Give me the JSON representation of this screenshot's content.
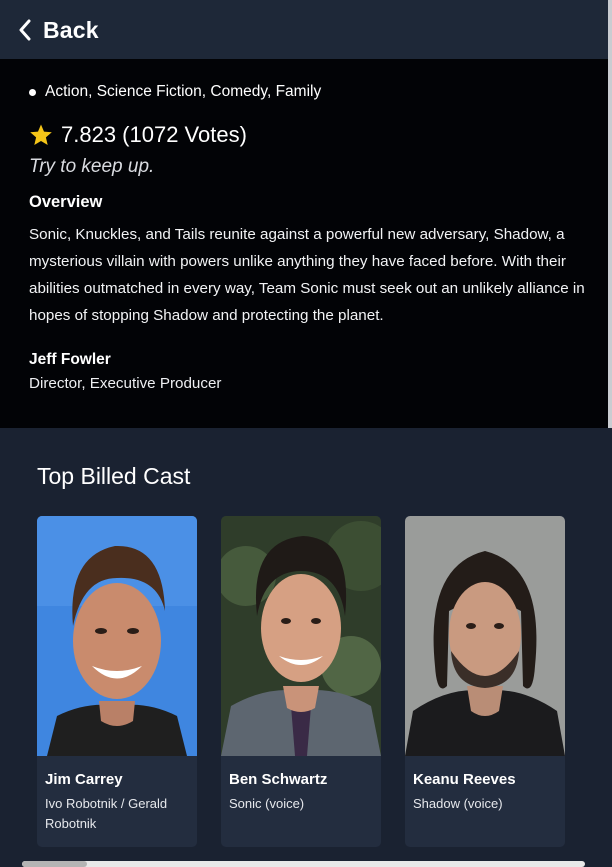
{
  "header": {
    "back_label": "Back"
  },
  "movie": {
    "genres": "Action, Science Fiction, Comedy, Family",
    "rating": "7.823 (1072 Votes)",
    "tagline": "Try to keep up.",
    "overview_title": "Overview",
    "overview": "Sonic, Knuckles, and Tails reunite against a powerful new adversary, Shadow, a mysterious villain with powers unlike anything they have faced before. With their abilities outmatched in every way, Team Sonic must seek out an unlikely alliance in hopes of stopping Shadow and protecting the planet.",
    "crew": {
      "name": "Jeff Fowler",
      "role": "Director, Executive Producer"
    }
  },
  "cast": {
    "title": "Top Billed Cast",
    "members": [
      {
        "name": "Jim Carrey",
        "character": "Ivo Robotnik / Gerald Robotnik"
      },
      {
        "name": "Ben Schwartz",
        "character": "Sonic (voice)"
      },
      {
        "name": "Keanu Reeves",
        "character": "Shadow (voice)"
      }
    ]
  },
  "colors": {
    "star": "#f5c518",
    "topbar": "#1e2838",
    "info_bg": "#020306",
    "cast_bg": "#1a2231",
    "card_bg": "#232d3f"
  },
  "icons": {
    "back": "chevron-left-icon",
    "rating": "star-icon"
  }
}
